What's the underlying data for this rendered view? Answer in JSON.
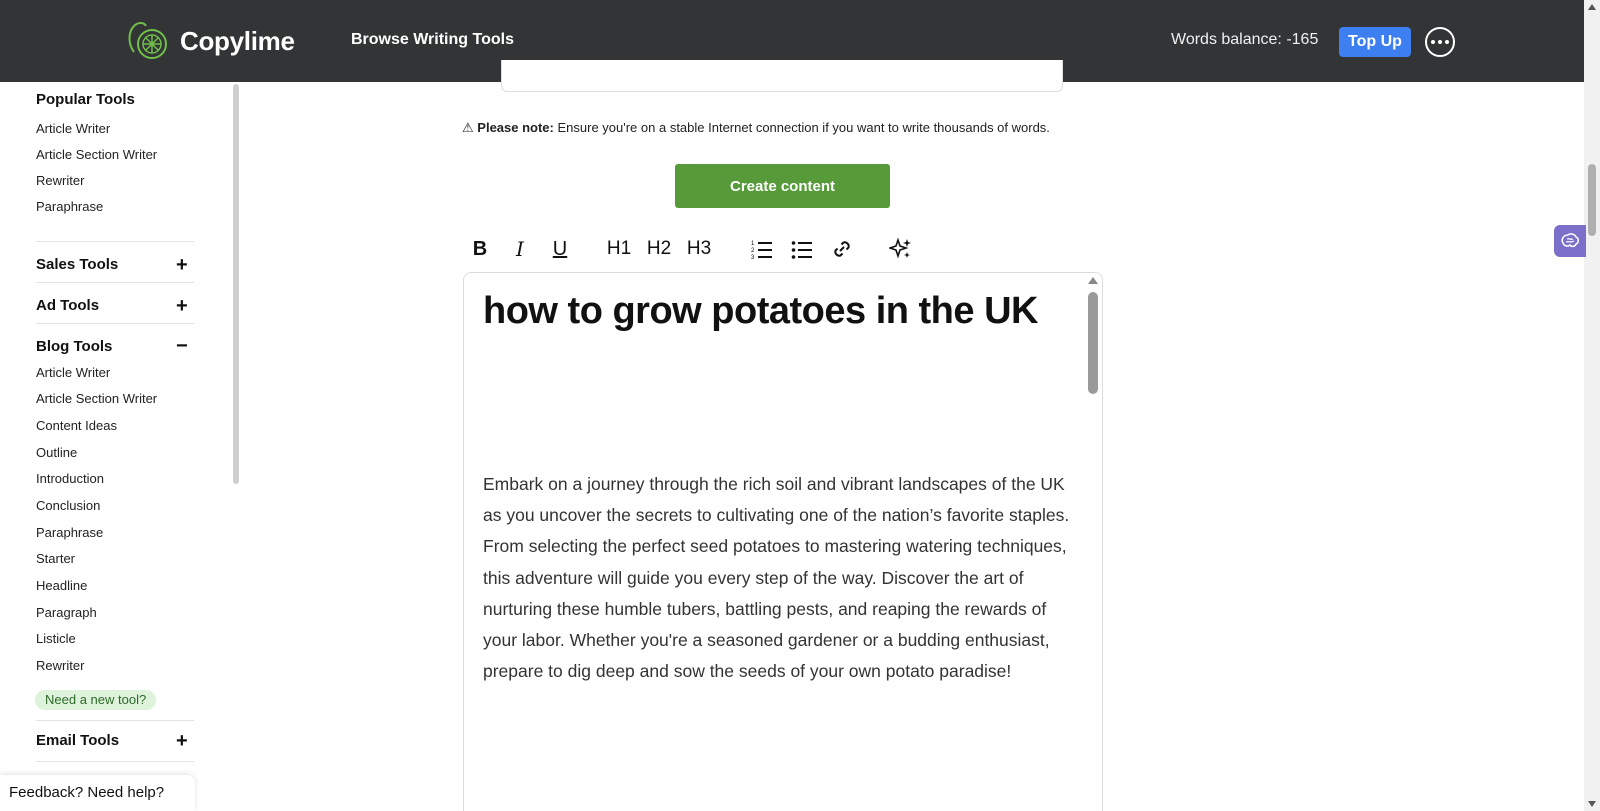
{
  "header": {
    "app_name": "Copylime",
    "browse_label": "Browse Writing Tools",
    "words_balance": "Words balance: -165",
    "topup_label": "Top Up"
  },
  "notice": {
    "bold": "Please note:",
    "text": " Ensure you're on a stable Internet connection if you want to write thousands of words."
  },
  "create_button": "Create content",
  "toolbar": {
    "bold": "B",
    "italic": "I",
    "underline": "U",
    "h1": "H1",
    "h2": "H2",
    "h3": "H3"
  },
  "sidebar": {
    "popular": {
      "title": "Popular Tools",
      "items": [
        "Article Writer",
        "Article Section Writer",
        "Rewriter",
        "Paraphrase"
      ]
    },
    "sales": {
      "title": "Sales Tools"
    },
    "ad": {
      "title": "Ad Tools"
    },
    "blog": {
      "title": "Blog Tools",
      "items": [
        "Article Writer",
        "Article Section Writer",
        "Content Ideas",
        "Outline",
        "Introduction",
        "Conclusion",
        "Paraphrase",
        "Starter",
        "Headline",
        "Paragraph",
        "Listicle",
        "Rewriter"
      ]
    },
    "need_tool": "Need a new tool?",
    "email": {
      "title": "Email Tools"
    },
    "feedback": "Feedback? Need help?"
  },
  "document": {
    "title": "how to grow potatoes in the UK",
    "body": "Embark on a journey through the rich soil and vibrant landscapes of the UK as you uncover the secrets to cultivating one of the nation’s favorite staples. From selecting the perfect seed potatoes to mastering watering techniques, this adventure will guide you every step of the way. Discover the art of nurturing these humble tubers, battling pests, and reaping the rewards of your labor. Whether you're a seasoned gardener or a budding enthusiast, prepare to dig deep and sow the seeds of your own potato paradise!"
  }
}
